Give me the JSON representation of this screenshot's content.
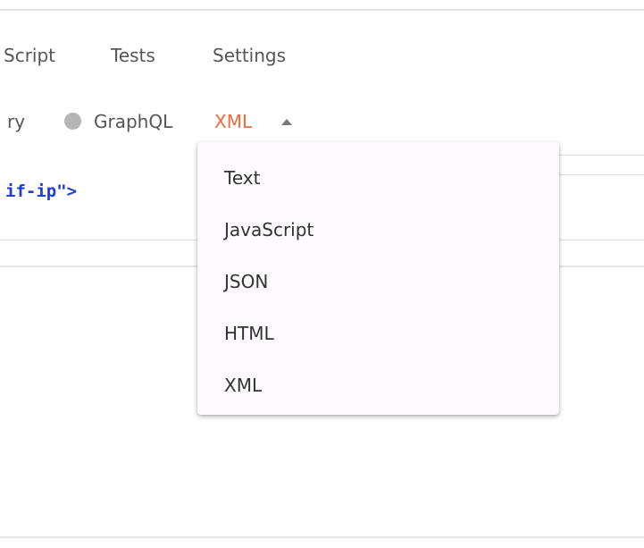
{
  "tabs": {
    "pre_request_script_partial": "Script",
    "tests": "Tests",
    "settings": "Settings"
  },
  "body_types": {
    "binary_partial": "ry",
    "graphql": "GraphQL",
    "selected": "XML"
  },
  "editor": {
    "visible_line": "if-ip\">"
  },
  "language_dropdown": {
    "options": [
      "Text",
      "JavaScript",
      "JSON",
      "HTML",
      "XML"
    ]
  },
  "colors": {
    "accent": "#ef6b3b",
    "code_text": "#1e3cd7",
    "radio_inactive": "#b5b5b5",
    "dropdown_bg": "#fdf9fc"
  },
  "icons": {
    "caret": "caret-up-icon",
    "radio": "radio-unselected-icon"
  }
}
